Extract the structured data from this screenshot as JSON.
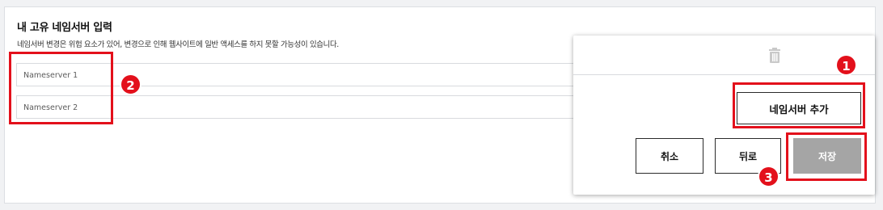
{
  "section": {
    "title": "내 고유 네임서버 입력",
    "description": "네임서버 변경은 위험 요소가 있어, 변경으로 인해 웹사이트에 일반 액세스를 하지 못할 가능성이 있습니다."
  },
  "nameservers": [
    {
      "placeholder": "Nameserver 1",
      "value": ""
    },
    {
      "placeholder": "Nameserver 2",
      "value": ""
    }
  ],
  "dialog": {
    "add_label": "네임서버 추가",
    "cancel_label": "취소",
    "back_label": "뒤로",
    "save_label": "저장",
    "save_state": "disabled"
  },
  "callouts": {
    "one": "1",
    "two": "2",
    "three": "3"
  },
  "colors": {
    "callout": "#e3101b",
    "save_disabled_bg": "#a5a5a5",
    "border": "#d8dade"
  },
  "icons": {
    "delete": "trash-icon"
  }
}
